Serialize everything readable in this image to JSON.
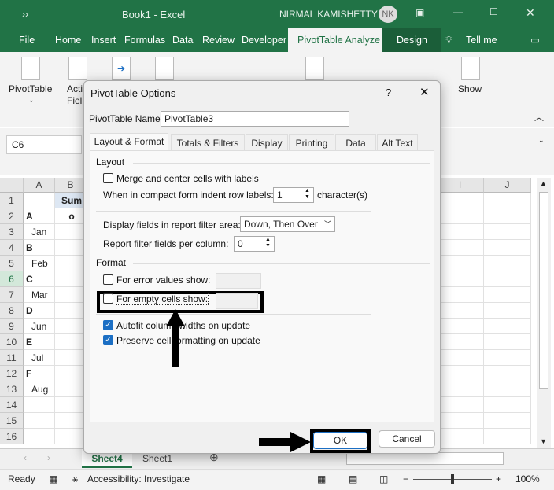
{
  "titlebar": {
    "qat": "››",
    "title": "Book1  -  Excel",
    "user": "NIRMAL KAMISHETTY",
    "initials": "NK"
  },
  "ribbon_tabs": [
    "File",
    "Home",
    "Insert",
    "Formulas",
    "Data",
    "Review",
    "Developer",
    "PivotTable Analyze",
    "Design",
    "Tell me"
  ],
  "ribbon": {
    "pivottable_label": "PivotTable",
    "active_field_label": "Acti\nFiel",
    "show_label": "Show"
  },
  "formula_bar": {
    "name_box": "C6"
  },
  "grid": {
    "columns": [
      "A",
      "B",
      "I",
      "J"
    ],
    "rows": [
      "1",
      "2",
      "3",
      "4",
      "5",
      "6",
      "7",
      "8",
      "9",
      "10",
      "11",
      "12",
      "13",
      "14",
      "15",
      "16"
    ],
    "cells": {
      "B1": "Sum o",
      "A2": "A",
      "A3": "Jan",
      "A4": "B",
      "A5": "Feb",
      "A6": "C",
      "A7": "Mar",
      "A8": "D",
      "A9": "Jun",
      "A10": "E",
      "A11": "Jul",
      "A12": "F",
      "A13": "Aug"
    }
  },
  "sheets": [
    "Sheet4",
    "Sheet1"
  ],
  "status": {
    "ready": "Ready",
    "accessibility": "Accessibility: Investigate",
    "zoom": "100%"
  },
  "dialog": {
    "title": "PivotTable Options",
    "help": "?",
    "name_label": "PivotTable Name:",
    "name_value": "PivotTable3",
    "tabs": [
      "Layout & Format",
      "Totals & Filters",
      "Display",
      "Printing",
      "Data",
      "Alt Text"
    ],
    "layout_heading": "Layout",
    "merge_label": "Merge and center cells with labels",
    "merge_checked": false,
    "indent_label": "When in compact form indent row labels:",
    "indent_value": "1",
    "indent_unit": "character(s)",
    "filter_area_label": "Display fields in report filter area:",
    "filter_area_value": "Down, Then Over",
    "filter_per_col_label": "Report filter fields per column:",
    "filter_per_col_value": "0",
    "format_heading": "Format",
    "error_label": "For error values show:",
    "error_checked": false,
    "error_value": "",
    "empty_label": "For empty cells show:",
    "empty_checked": false,
    "empty_value": "",
    "autofit_label": "Autofit column widths on update",
    "autofit_checked": true,
    "preserve_label": "Preserve cell formatting on update",
    "preserve_checked": true,
    "ok": "OK",
    "cancel": "Cancel"
  },
  "colors": {
    "excel_green": "#217346",
    "check_blue": "#1c6fc4"
  }
}
